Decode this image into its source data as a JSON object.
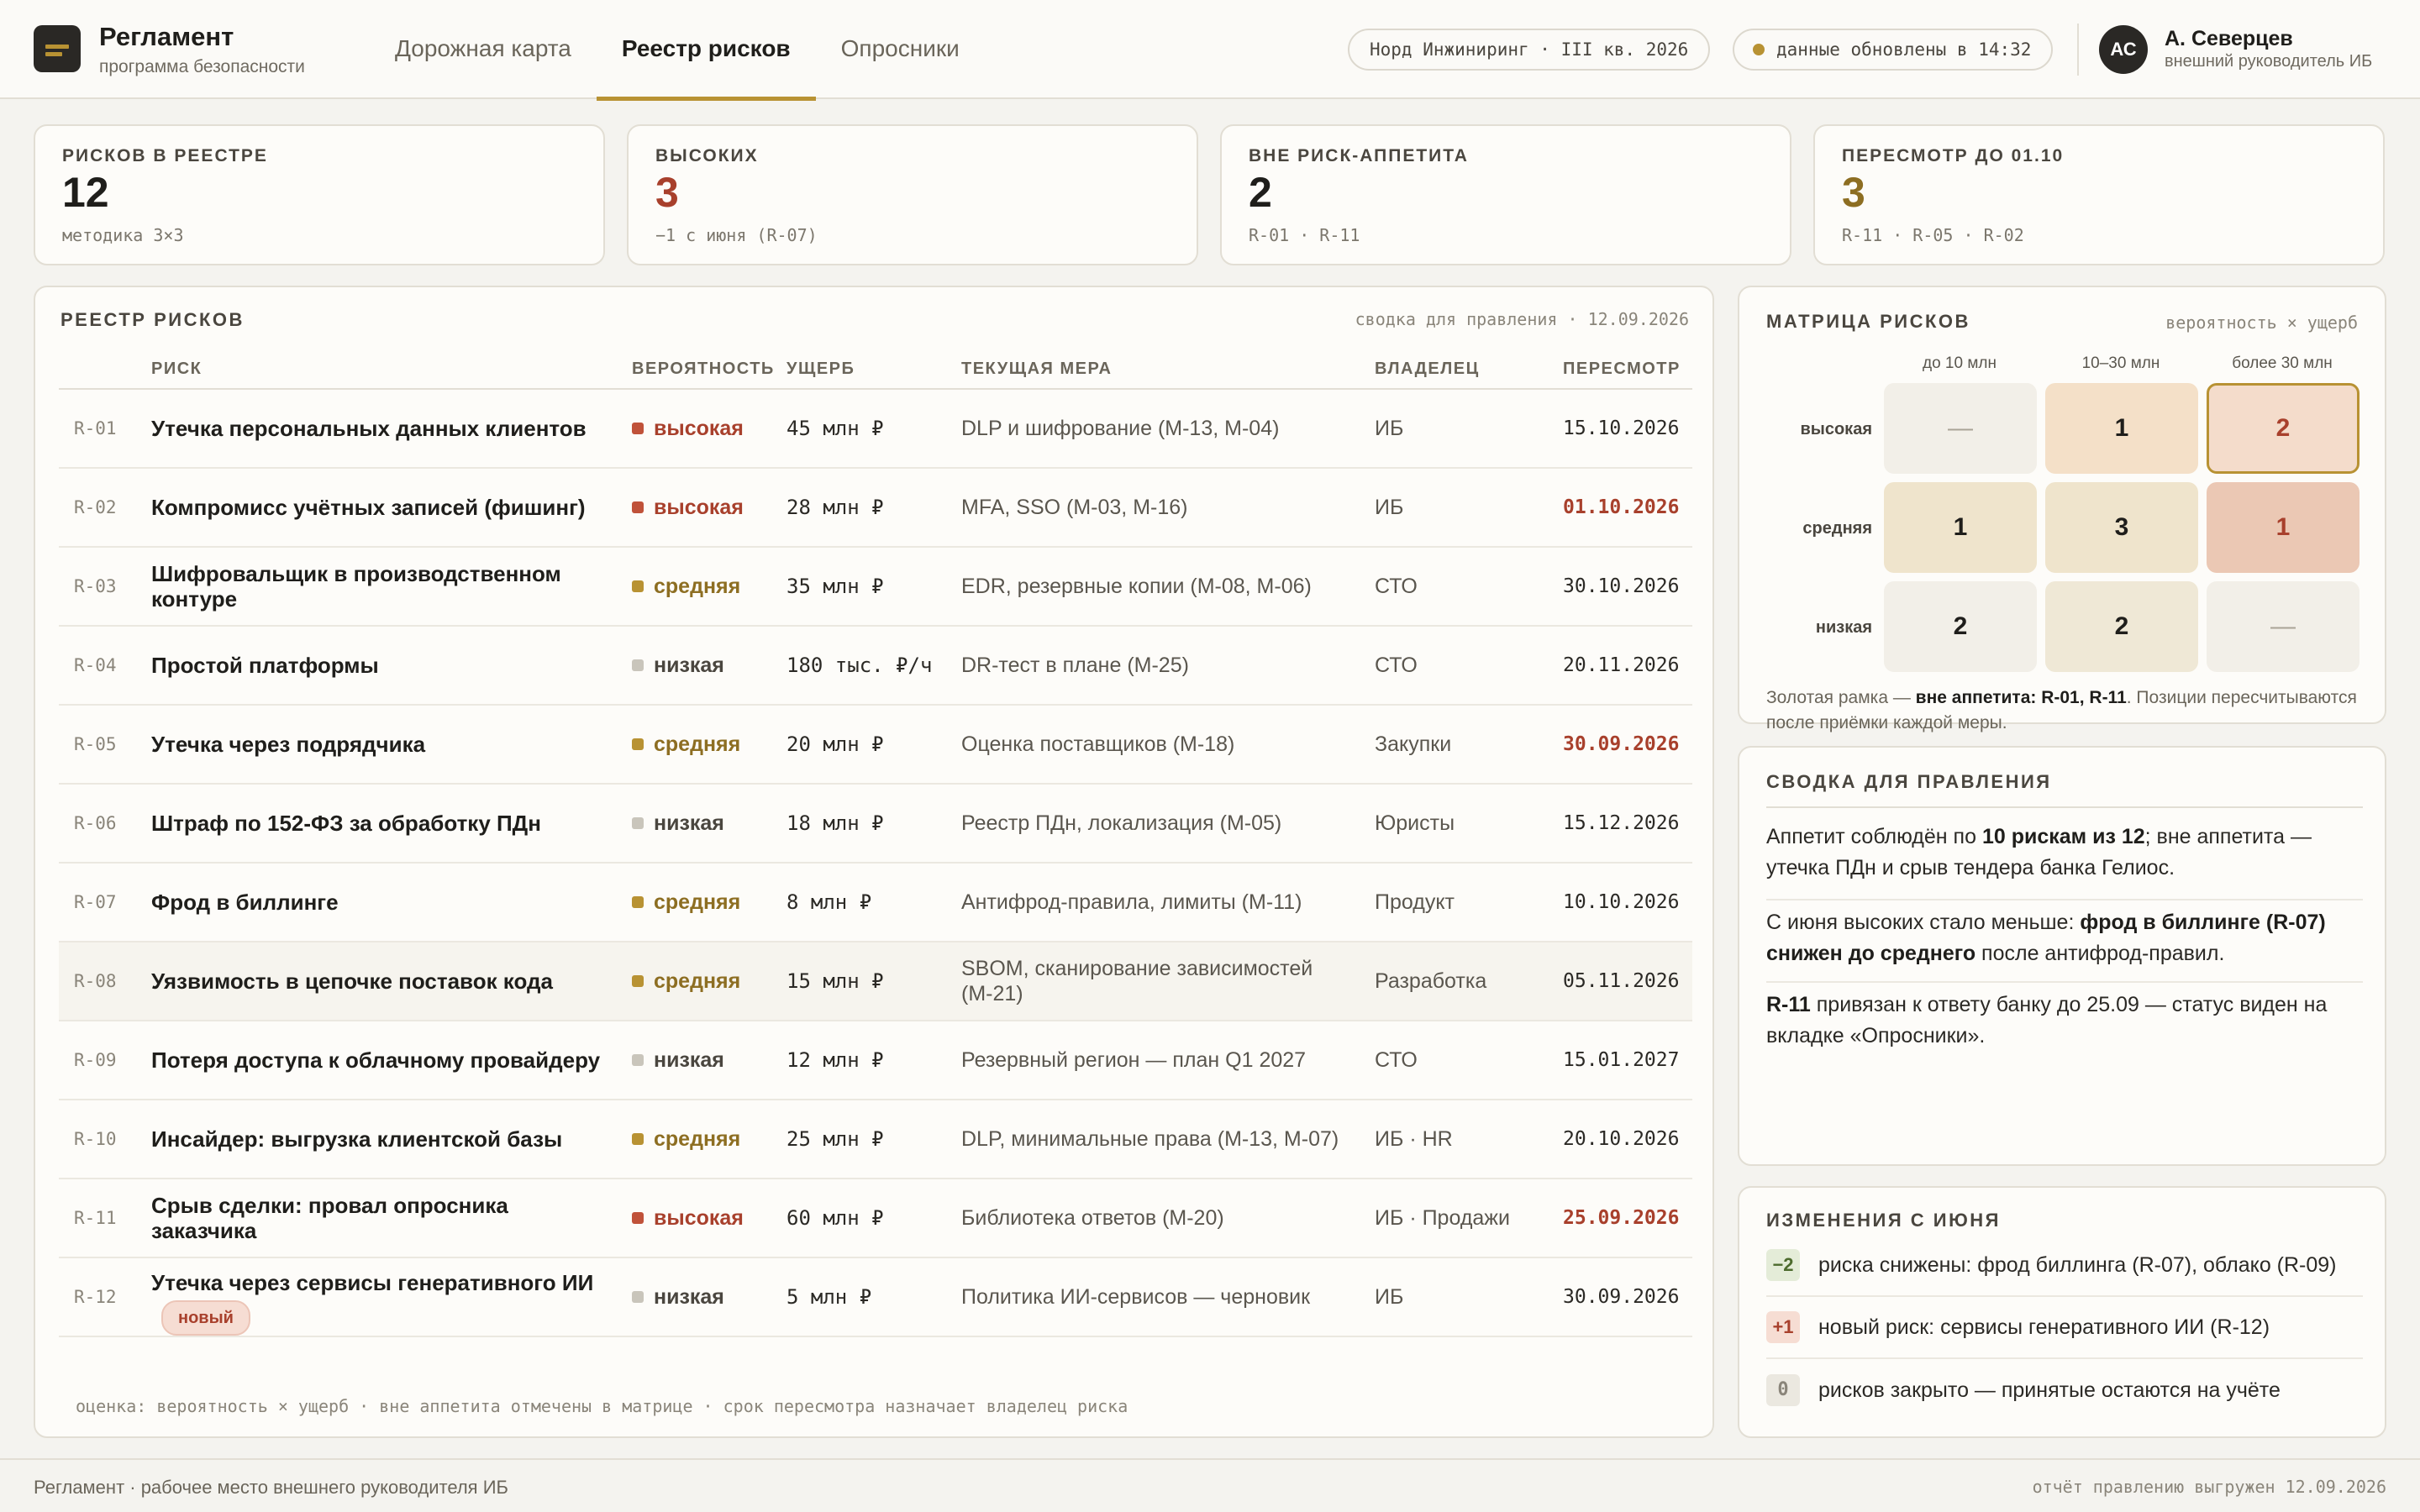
{
  "app": {
    "title": "Регламент",
    "subtitle": "программа безопасности"
  },
  "nav": [
    {
      "label": "Дорожная карта",
      "active": false
    },
    {
      "label": "Реестр рисков",
      "active": true
    },
    {
      "label": "Опросники",
      "active": false
    }
  ],
  "header": {
    "org_pill": "Норд Инжиниринг · III кв. 2026",
    "updated_pill": "данные обновлены в 14:32",
    "user_initials": "АС",
    "user_name": "А. Северцев",
    "user_role": "внешний руководитель ИБ"
  },
  "kpis": [
    {
      "label": "РИСКОВ В РЕЕСТРЕ",
      "value": "12",
      "sub": "методика 3×3",
      "tone": "default"
    },
    {
      "label": "ВЫСОКИХ",
      "value": "3",
      "sub": "−1 с июня (R-07)",
      "tone": "red"
    },
    {
      "label": "ВНЕ РИСК-АППЕТИТА",
      "value": "2",
      "sub": "R-01 · R-11",
      "tone": "default"
    },
    {
      "label": "ПЕРЕСМОТР ДО 01.10",
      "value": "3",
      "sub": "R-11 · R-05 · R-02",
      "tone": "gold"
    }
  ],
  "register": {
    "title": "РЕЕСТР РИСКОВ",
    "meta": "сводка для правления · 12.09.2026",
    "columns": {
      "risk": "РИСК",
      "prob": "ВЕРОЯТНОСТЬ",
      "dmg": "УЩЕРБ",
      "measure": "ТЕКУЩАЯ МЕРА",
      "owner": "ВЛАДЕЛЕЦ",
      "review": "ПЕРЕСМОТР"
    },
    "rows": [
      {
        "id": "R-01",
        "name": "Утечка персональных данных клиентов",
        "prob": "высокая",
        "level": "high",
        "dmg": "45 млн ₽",
        "measure": "DLP и шифрование (М-13, М-04)",
        "owner": "ИБ",
        "review": "15.10.2026",
        "late": false,
        "badge": ""
      },
      {
        "id": "R-02",
        "name": "Компромисс учётных записей (фишинг)",
        "prob": "высокая",
        "level": "high",
        "dmg": "28 млн ₽",
        "measure": "MFA, SSO (М-03, М-16)",
        "owner": "ИБ",
        "review": "01.10.2026",
        "late": true,
        "badge": ""
      },
      {
        "id": "R-03",
        "name": "Шифровальщик в производственном контуре",
        "prob": "средняя",
        "level": "mid",
        "dmg": "35 млн ₽",
        "measure": "EDR, резервные копии (М-08, М-06)",
        "owner": "СТО",
        "review": "30.10.2026",
        "late": false,
        "badge": ""
      },
      {
        "id": "R-04",
        "name": "Простой платформы",
        "prob": "низкая",
        "level": "low",
        "dmg": "180 тыс. ₽/ч",
        "measure": "DR-тест в плане (М-25)",
        "owner": "СТО",
        "review": "20.11.2026",
        "late": false,
        "badge": ""
      },
      {
        "id": "R-05",
        "name": "Утечка через подрядчика",
        "prob": "средняя",
        "level": "mid",
        "dmg": "20 млн ₽",
        "measure": "Оценка поставщиков (М-18)",
        "owner": "Закупки",
        "review": "30.09.2026",
        "late": true,
        "badge": ""
      },
      {
        "id": "R-06",
        "name": "Штраф по 152-ФЗ за обработку ПДн",
        "prob": "низкая",
        "level": "low",
        "dmg": "18 млн ₽",
        "measure": "Реестр ПДн, локализация (М-05)",
        "owner": "Юристы",
        "review": "15.12.2026",
        "late": false,
        "badge": ""
      },
      {
        "id": "R-07",
        "name": "Фрод в биллинге",
        "prob": "средняя",
        "level": "mid",
        "dmg": "8 млн ₽",
        "measure": "Антифрод-правила, лимиты (М-11)",
        "owner": "Продукт",
        "review": "10.10.2026",
        "late": false,
        "badge": ""
      },
      {
        "id": "R-08",
        "name": "Уязвимость в цепочке поставок кода",
        "prob": "средняя",
        "level": "mid",
        "dmg": "15 млн ₽",
        "measure": "SBOM, сканирование зависимостей (М-21)",
        "owner": "Разработка",
        "review": "05.11.2026",
        "late": false,
        "badge": ""
      },
      {
        "id": "R-09",
        "name": "Потеря доступа к облачному провайдеру",
        "prob": "низкая",
        "level": "low",
        "dmg": "12 млн ₽",
        "measure": "Резервный регион — план Q1 2027",
        "owner": "СТО",
        "review": "15.01.2027",
        "late": false,
        "badge": ""
      },
      {
        "id": "R-10",
        "name": "Инсайдер: выгрузка клиентской базы",
        "prob": "средняя",
        "level": "mid",
        "dmg": "25 млн ₽",
        "measure": "DLP, минимальные права (М-13, М-07)",
        "owner": "ИБ · HR",
        "review": "20.10.2026",
        "late": false,
        "badge": ""
      },
      {
        "id": "R-11",
        "name": "Срыв сделки: провал опросника заказчика",
        "prob": "высокая",
        "level": "high",
        "dmg": "60 млн ₽",
        "measure": "Библиотека ответов (М-20)",
        "owner": "ИБ · Продажи",
        "review": "25.09.2026",
        "late": true,
        "badge": ""
      },
      {
        "id": "R-12",
        "name": "Утечка через сервисы генеративного ИИ",
        "prob": "низкая",
        "level": "low",
        "dmg": "5 млн ₽",
        "measure": "Политика ИИ-сервисов — черновик",
        "owner": "ИБ",
        "review": "30.09.2026",
        "late": false,
        "badge": "новый"
      }
    ],
    "footnote": "оценка: вероятность × ущерб · вне аппетита отмечены в матрице · срок пересмотра назначает владелец риска"
  },
  "matrix": {
    "title": "МАТРИЦА РИСКОВ",
    "meta": "вероятность × ущерб",
    "cols": [
      "до 10 млн",
      "10–30 млн",
      "более 30 млн"
    ],
    "rows": [
      {
        "label": "высокая",
        "cells": [
          "—",
          "1",
          "2"
        ]
      },
      {
        "label": "средняя",
        "cells": [
          "1",
          "3",
          "1"
        ]
      },
      {
        "label": "низкая",
        "cells": [
          "2",
          "2",
          "—"
        ]
      }
    ],
    "note_pre": "Золотая рамка — ",
    "note_bold": "вне аппетита: R-01, R-11",
    "note_post": ". Позиции пересчитываются после приёмки каждой меры."
  },
  "summary": {
    "title": "СВОДКА ДЛЯ ПРАВЛЕНИЯ",
    "p1_a": "Аппетит соблюдён по ",
    "p1_b": "10 рискам из 12",
    "p1_c": "; вне аппетита — утечка ПДн и срыв тендера банка Гелиос.",
    "p2_a": "С июня высоких стало меньше: ",
    "p2_b": "фрод в биллинге (R-07) снижен до среднего",
    "p2_c": " после антифрод-правил.",
    "p3_a": "R-11",
    "p3_b": " привязан к ответу банку до 25.09 — статус виден на вкладке «Опросники»."
  },
  "changes": {
    "title": "ИЗМЕНЕНИЯ С ИЮНЯ",
    "items": [
      {
        "badge": "−2",
        "tone": "green",
        "text": "риска снижены: фрод биллинга (R-07), облако (R-09)"
      },
      {
        "badge": "+1",
        "tone": "red",
        "text": "новый риск: сервисы генеративного ИИ (R-12)"
      },
      {
        "badge": "0",
        "tone": "grey",
        "text": "рисков закрыто — принятые остаются на учёте"
      }
    ]
  },
  "footer": {
    "left": "Регламент · рабочее место внешнего руководителя ИБ",
    "right": "отчёт правлению выгружен 12.09.2026"
  },
  "colors": {
    "accent": "#b89233",
    "high": "#c0523a",
    "mid": "#b89233",
    "low": "#c9c5bb",
    "matrix_low": "#f2efe8",
    "matrix_warm": "#efe4cc",
    "matrix_peach": "#f4e0c8",
    "matrix_hot": "#ebc8b4"
  }
}
